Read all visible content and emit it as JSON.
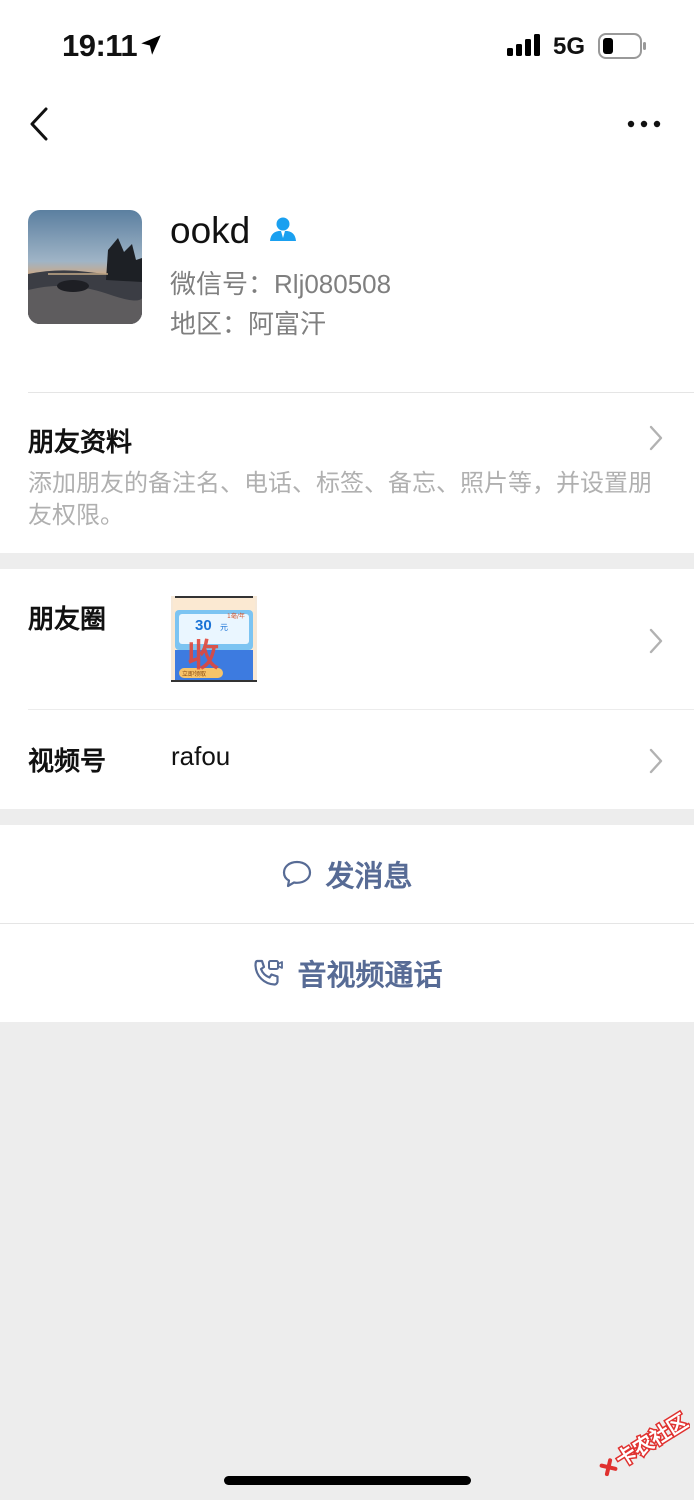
{
  "status_bar": {
    "time": "19:11",
    "network": "5G",
    "battery_percent": 25
  },
  "nav": {
    "back_icon": "chevron-left-icon",
    "more_icon": "ellipsis-icon"
  },
  "profile": {
    "nickname": "ookd",
    "wechat_id_label": "微信号：",
    "wechat_id": "Rlj080508",
    "region_label": "地区：",
    "region": "阿富汗"
  },
  "friend_info": {
    "title": "朋友资料",
    "description": "添加朋友的备注名、电话、标签、备忘、照片等，并设置朋友权限。"
  },
  "moments": {
    "label": "朋友圈",
    "thumbnail_text": {
      "amount": "30",
      "unit": "元",
      "tag": "1毫/年",
      "big": "收",
      "button": "立即领取"
    }
  },
  "channels": {
    "label": "视频号",
    "value": "rafou"
  },
  "actions": {
    "message": "发消息",
    "call": "音视频通话"
  },
  "watermark": "卡农社区",
  "colors": {
    "link_blue": "#576b95",
    "contact_icon": "#1aa0f0",
    "background": "#ededed"
  }
}
